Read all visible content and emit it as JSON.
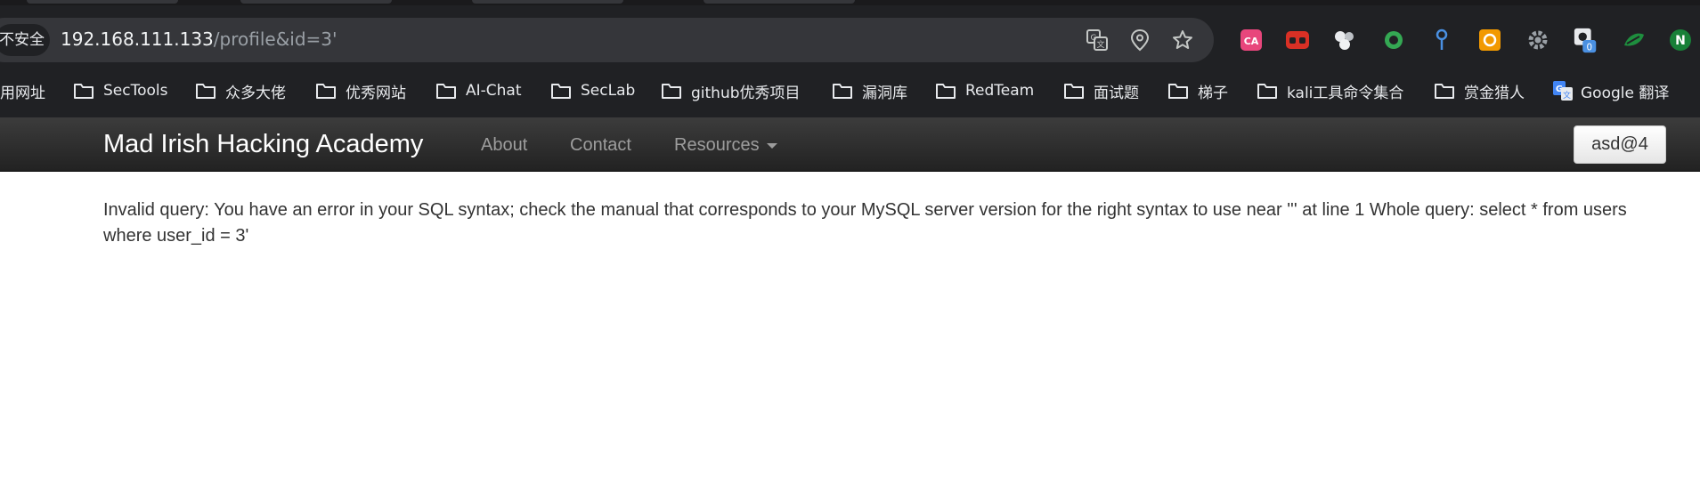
{
  "browser": {
    "security_label": "不安全",
    "url_host": "192.168.111.133",
    "url_path": "/profile&id=3'",
    "omnibox_icons": [
      "translate-icon",
      "location-icon",
      "star-icon"
    ],
    "extensions": [
      {
        "name": "translate-ext-icon",
        "color": "#e8467c",
        "label": "CA"
      },
      {
        "name": "glasses-ext-icon",
        "color": "#d93025",
        "label": ""
      },
      {
        "name": "cluster-ext-icon",
        "color": "#e8eaed",
        "label": ""
      },
      {
        "name": "ring-ext-icon",
        "color": "#34a853",
        "label": ""
      },
      {
        "name": "pin-ext-icon",
        "color": "#4a90e2",
        "label": ""
      },
      {
        "name": "box-ext-icon",
        "color": "#f29900",
        "label": ""
      },
      {
        "name": "gear-ext-icon",
        "color": "#9aa0a6",
        "label": ""
      },
      {
        "name": "camera-ext-icon",
        "color": "#e8eaed",
        "label": "0"
      },
      {
        "name": "leaf-ext-icon",
        "color": "#1e8e3e",
        "label": ""
      },
      {
        "name": "n-ext-icon",
        "color": "#188038",
        "label": "N"
      }
    ]
  },
  "bookmarks": [
    {
      "label": "用网址",
      "folder": false
    },
    {
      "label": "SecTools",
      "folder": true
    },
    {
      "label": "众多大佬",
      "folder": true
    },
    {
      "label": "优秀网站",
      "folder": true
    },
    {
      "label": "AI-Chat",
      "folder": true
    },
    {
      "label": "SecLab",
      "folder": true
    },
    {
      "label": "github优秀项目",
      "folder": true
    },
    {
      "label": "漏洞库",
      "folder": true
    },
    {
      "label": "RedTeam",
      "folder": true
    },
    {
      "label": "面试题",
      "folder": true
    },
    {
      "label": "梯子",
      "folder": true
    },
    {
      "label": "kali工具命令集合",
      "folder": true
    },
    {
      "label": "赏金猎人",
      "folder": true
    },
    {
      "label": "Google 翻译",
      "folder": false
    }
  ],
  "navbar": {
    "brand": "Mad Irish Hacking Academy",
    "links": [
      "About",
      "Contact",
      "Resources"
    ],
    "user_button": "asd@4"
  },
  "content": {
    "message": "Invalid query: You have an error in your SQL syntax; check the manual that corresponds to your MySQL server version for the right syntax to use near ''' at line 1 Whole query: select * from users where user_id = 3'"
  }
}
